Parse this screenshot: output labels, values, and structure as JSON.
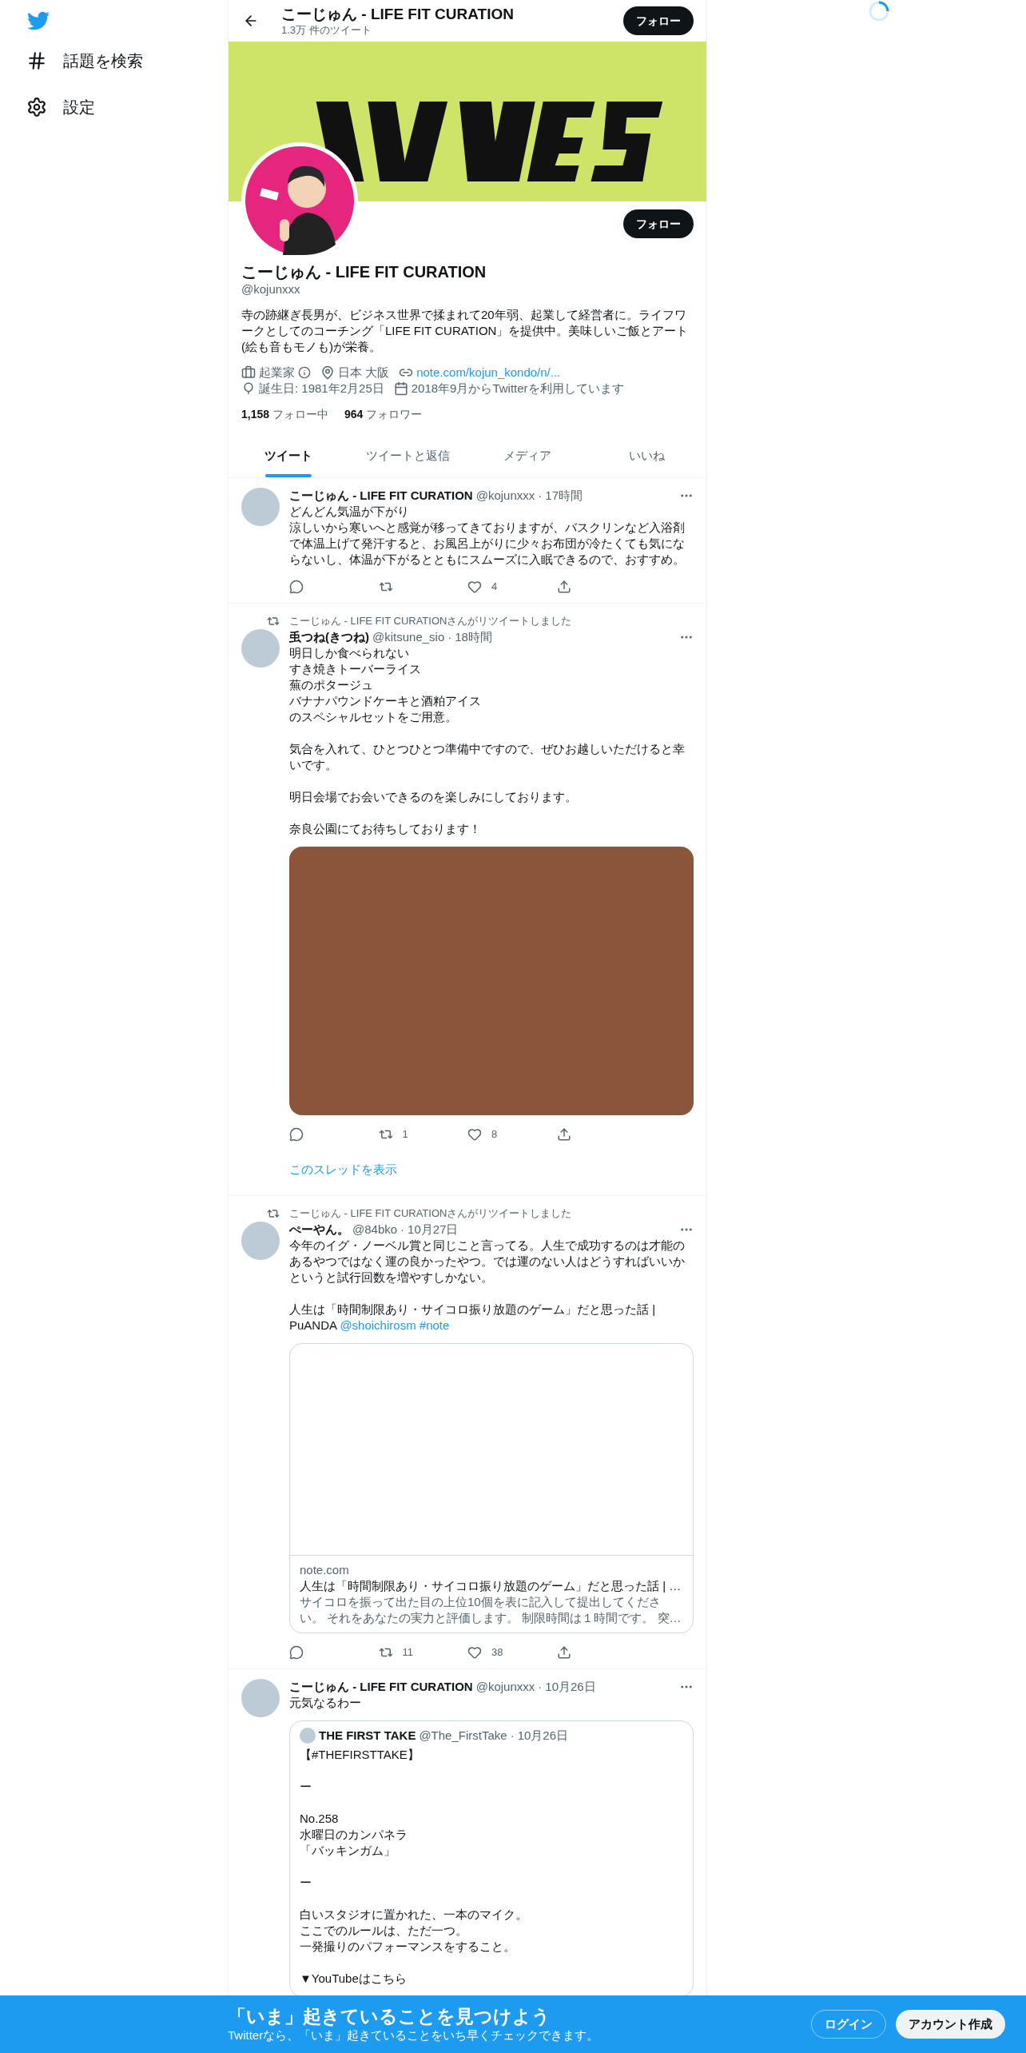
{
  "sidebar": {
    "items": [
      {
        "kind": "hash",
        "label": "話題を検索"
      },
      {
        "kind": "settings",
        "label": "設定"
      }
    ]
  },
  "header": {
    "title": "こーじゅん - LIFE FIT CURATION",
    "subtitle": "1.3万 件のツイート",
    "button": "フォロー"
  },
  "profile": {
    "banner": {
      "kind": "picture"
    },
    "avatar": {
      "kind": "picture"
    },
    "button": "フォロー",
    "name": "こーじゅん - LIFE FIT CURATION",
    "handle": "@kojunxxx",
    "bio": "寺の跡継ぎ長男が、ビジネス世界で揉まれて20年弱、起業して経営者に。ライフワークとしてのコーチング「LIFE FIT CURATION」を提供中。美味しいご飯とアート(絵も音もモノも)が栄養。",
    "meta": [
      {
        "kind": "job",
        "text": "起業家",
        "info": true
      },
      {
        "kind": "location",
        "text": "日本 大阪"
      },
      {
        "kind": "link",
        "text": "note.com/kojun_kondo/n/..."
      },
      {
        "kind": "birthday",
        "text": "誕生日: 1981年2月25日"
      },
      {
        "kind": "joined",
        "text": "2018年9月からTwitterを利用しています"
      }
    ],
    "stats": [
      {
        "count": "1,158",
        "label": "フォロー中"
      },
      {
        "count": "964",
        "label": "フォロワー"
      }
    ]
  },
  "tabs": [
    {
      "label": "ツイート",
      "selected": true
    },
    {
      "label": "ツイートと返信",
      "selected": false
    },
    {
      "label": "メディア",
      "selected": false
    },
    {
      "label": "いいね",
      "selected": false
    }
  ],
  "tweets": [
    {
      "name": "こーじゅん - LIFE FIT CURATION",
      "handle": "@kojunxxx",
      "dot": "·",
      "time": "17時間",
      "paragraphs": [
        [
          "どんどん気温が下がり",
          "涼しいから寒いへと感覚が移ってきておりますが、バスクリンなど入浴剤で体温上げて発汗すると、お風呂上がりに少々お布団が冷たくても気にならないし、体温が下がるとともにスムーズに入眠できるので、おすすめ。"
        ]
      ],
      "actions": [
        {
          "kind": "reply"
        },
        {
          "kind": "retweet"
        },
        {
          "kind": "like",
          "count": "4"
        },
        {
          "kind": "share"
        }
      ]
    },
    {
      "retweeted_by": "こーじゅん - LIFE FIT CURATIONさんがリツイートしました",
      "name": "䖝つね(きつね)",
      "handle": "@kitsune_sio",
      "dot": "·",
      "time": "18時間",
      "paragraphs": [
        [
          "明日しか食べられない",
          "すき焼きトーバーライス",
          "蕪のポタージュ",
          "バナナパウンドケーキと酒粕アイス",
          "のスペシャルセットをご用意。"
        ],
        [
          "気合を入れて、ひとつひとつ準備中ですので、ぜひお越しいただけると幸いです。"
        ],
        [
          "明日会場でお会いできるのを楽しみにしております。"
        ],
        [
          "奈良公園にてお待ちしております！"
        ]
      ],
      "media": {
        "kind": "picture"
      },
      "actions": [
        {
          "kind": "reply"
        },
        {
          "kind": "retweet",
          "count": "1"
        },
        {
          "kind": "like",
          "count": "8"
        },
        {
          "kind": "share"
        }
      ],
      "thread_link": "このスレッドを表示"
    },
    {
      "retweeted_by": "こーじゅん - LIFE FIT CURATIONさんがリツイートしました",
      "name": "ぺーやん。",
      "handle": "@84bko",
      "dot": "·",
      "time": "10月27日",
      "paragraphs": [
        [
          "今年のイグ・ノーベル賞と同じこと言ってる。人生で成功するのは才能のあるやつではなく運の良かったやつ。では運のない人はどうすればいいかというと試行回数を増やすしかない。"
        ],
        [
          "人生は「時間制限あり・サイコロ振り放題のゲーム」だと思った話 | PuANDA"
        ]
      ],
      "links": [
        "@shoichirosm",
        "#note"
      ],
      "card": {
        "domain": "note.com",
        "title": "人生は「時間制限あり・サイコロ振り放題のゲーム」だと思った話 | …",
        "description": "サイコロを振って出た目の上位10個を表に記入して提出してください。 それをあなたの実力と評価します。 制限時間は１時間です。 突…"
      },
      "actions": [
        {
          "kind": "reply"
        },
        {
          "kind": "retweet",
          "count": "11"
        },
        {
          "kind": "like",
          "count": "38"
        },
        {
          "kind": "share"
        }
      ]
    },
    {
      "name": "こーじゅん - LIFE FIT CURATION",
      "handle": "@kojunxxx",
      "dot": "·",
      "time": "10月26日",
      "paragraphs": [
        [
          "元気なるわー"
        ]
      ],
      "quote": {
        "name": "THE FIRST TAKE",
        "handle": "@The_FirstTake",
        "dot": "·",
        "time": "10月26日",
        "paragraphs": [
          [
            "【#THEFIRSTTAKE】"
          ],
          [
            "ー"
          ],
          [
            "No.258",
            "水曜日のカンパネラ",
            "「バッキンガム」"
          ],
          [
            "ー"
          ],
          [
            "白いスタジオに置かれた、一本のマイク。",
            "ここでのルールは、ただ一つ。",
            "一発撮りのパフォーマンスをすること。"
          ],
          [
            "▼YouTubeはこちら"
          ]
        ]
      }
    }
  ],
  "bottom_bar": {
    "title": "「いま」起きていることを見つけよう",
    "subtitle": "Twitterなら、「いま」起きていることをいち早くチェックできます。",
    "buttons": [
      {
        "kind": "outline",
        "label": "ログイン"
      },
      {
        "kind": "filled",
        "label": "アカウント作成"
      }
    ]
  }
}
